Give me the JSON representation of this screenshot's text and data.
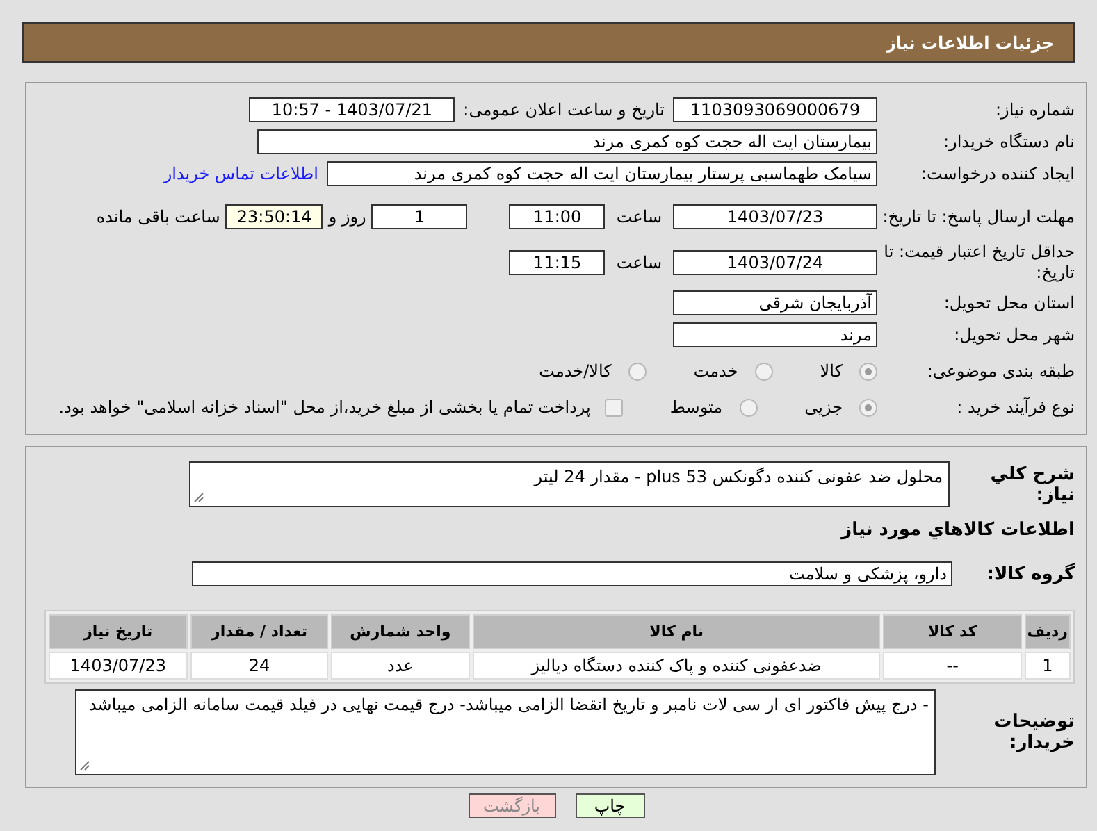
{
  "header": {
    "title": "جزئیات اطلاعات نیاز"
  },
  "need_number": {
    "label": "شماره نیاز:",
    "value": "1103093069000679"
  },
  "announce": {
    "label": "تاریخ و ساعت اعلان عمومی:",
    "value": "1403/07/21 - 10:57"
  },
  "buyer_org": {
    "label": "نام دستگاه خریدار:",
    "value": "بیمارستان ایت اله حجت کوه کمری مرند"
  },
  "requester": {
    "label": "ایجاد کننده درخواست:",
    "value": "سیامک طهماسبی پرستار بیمارستان ایت اله حجت کوه کمری مرند",
    "link": "اطلاعات تماس خریدار"
  },
  "reply_deadline": {
    "label": "مهلت ارسال پاسخ: تا تاریخ:",
    "date": "1403/07/23",
    "time_label": "ساعت",
    "time": "11:00",
    "days": "1",
    "days_label": "روز و",
    "remaining": "23:50:14",
    "remaining_label": "ساعت باقی مانده"
  },
  "price_validity": {
    "label": "حداقل تاریخ اعتبار قیمت: تا تاریخ:",
    "date": "1403/07/24",
    "time_label": "ساعت",
    "time": "11:15"
  },
  "province": {
    "label": "استان محل تحویل:",
    "value": "آذربایجان شرقی"
  },
  "city": {
    "label": "شهر محل تحویل:",
    "value": "مرند"
  },
  "category": {
    "label": "طبقه بندی موضوعی:",
    "options": [
      {
        "label": "کالا",
        "selected": true
      },
      {
        "label": "خدمت",
        "selected": false
      },
      {
        "label": "کالا/خدمت",
        "selected": false
      }
    ]
  },
  "process": {
    "label": "نوع فرآیند خرید :",
    "options": [
      {
        "label": "جزیی",
        "selected": true
      },
      {
        "label": "متوسط",
        "selected": false
      }
    ],
    "payment": {
      "label": "پرداخت تمام یا بخشی از مبلغ خرید،از محل \"اسناد خزانه اسلامی\" خواهد بود.",
      "checked": false
    }
  },
  "summary": {
    "label": "شرح کلي نياز:",
    "value": "محلول ضد عفونی کننده دگونکس plus 53 - مقدار 24 لیتر"
  },
  "items_title": "اطلاعات کالاهاي مورد نياز",
  "goods_group": {
    "label": "گروه کالا:",
    "value": "دارو، پزشکی و سلامت"
  },
  "table": {
    "columns": [
      "ردیف",
      "کد کالا",
      "نام کالا",
      "واحد شمارش",
      "تعداد / مقدار",
      "تاریخ نیاز"
    ],
    "rows": [
      [
        "1",
        "--",
        "ضدعفونی کننده و پاک کننده دستگاه دیالیز",
        "عدد",
        "24",
        "1403/07/23"
      ]
    ]
  },
  "buyer_notes": {
    "label": "توضیحات خریدار:",
    "value": "- درج پیش فاکتور ای ار سی لات نامبر و تاریخ انقضا الزامی میباشد- درج قیمت نهایی در فیلد قیمت سامانه الزامی میباشد"
  },
  "buttons": [
    {
      "label": "چاپ",
      "kind": "print"
    },
    {
      "label": "بازگشت",
      "kind": "back"
    }
  ]
}
